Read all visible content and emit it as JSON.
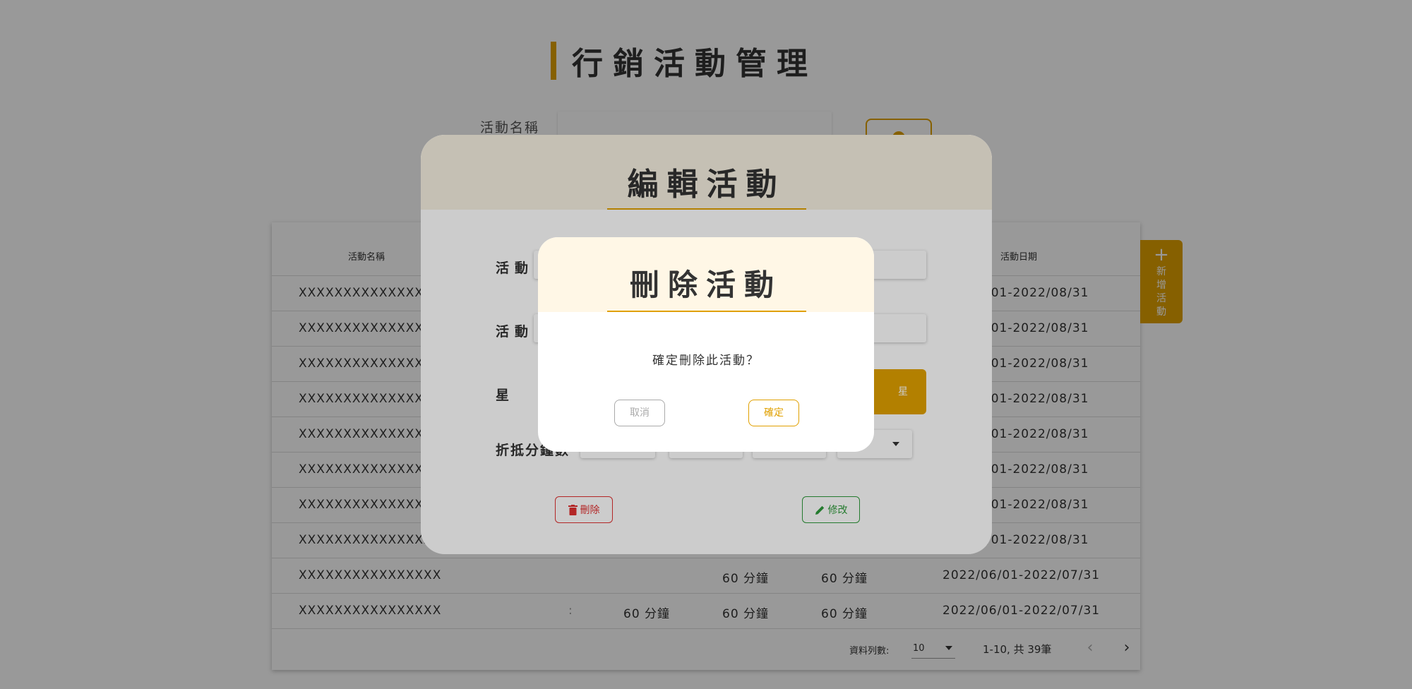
{
  "page": {
    "title": "行銷活動管理",
    "search_label": "活動名稱",
    "search_value": ""
  },
  "table": {
    "headers": {
      "name": "活動名稱",
      "date": "活動日期"
    },
    "rows": [
      {
        "name": "XXXXXXXXXXXXXXXX",
        "date": "/01-2022/08/31"
      },
      {
        "name": "XXXXXXXXXXXXXXXX",
        "date": "/01-2022/08/31"
      },
      {
        "name": "XXXXXXXXXXXXXXXX",
        "date": "/01-2022/08/31"
      },
      {
        "name": "XXXXXXXXXXXXXXXX",
        "date": "/01-2022/08/31"
      },
      {
        "name": "XXXXXXXXXXXXXXXX",
        "date": "/01-2022/08/31"
      },
      {
        "name": "XXXXXXXXXXXXXXXX",
        "date": "/01-2022/08/31"
      },
      {
        "name": "XXXXXXXXXXXXXXXX",
        "date": "/01-2022/08/31"
      },
      {
        "name": "XXXXXXXXXXXXXXXX",
        "date": "/01-2022/08/31"
      },
      {
        "name": "XXXXXXXXXXXXXXXX",
        "m1": "",
        "m2": "60 分鐘",
        "m3": "60 分鐘",
        "date": "2022/06/01-2022/07/31"
      },
      {
        "name": "XXXXXXXXXXXXXXXX",
        "m1": "60 分鐘",
        "m2": "60 分鐘",
        "m3": "60 分鐘",
        "date": "2022/06/01-2022/07/31",
        "colon": ":"
      }
    ],
    "footer": {
      "rows_label": "資料列數:",
      "rows_value": "10",
      "range": "1-10, 共 39筆",
      "prev": "‹",
      "next": "›"
    }
  },
  "add_button": {
    "plus": "+",
    "label": "新增活動"
  },
  "edit_modal": {
    "title": "編輯活動",
    "labels": {
      "name": "活動名",
      "date": "活動日",
      "star": "星",
      "discount": "折抵分鐘數"
    },
    "star_btn": "星",
    "delete_label": "刪除",
    "edit_label": "修改"
  },
  "delete_modal": {
    "title": "刪除活動",
    "message": "確定刪除此活動？",
    "cancel_label": "取消",
    "confirm_label": "確定"
  },
  "colors": {
    "accent": "#e0a000",
    "danger": "#e03030",
    "success": "#2e9a3a"
  }
}
